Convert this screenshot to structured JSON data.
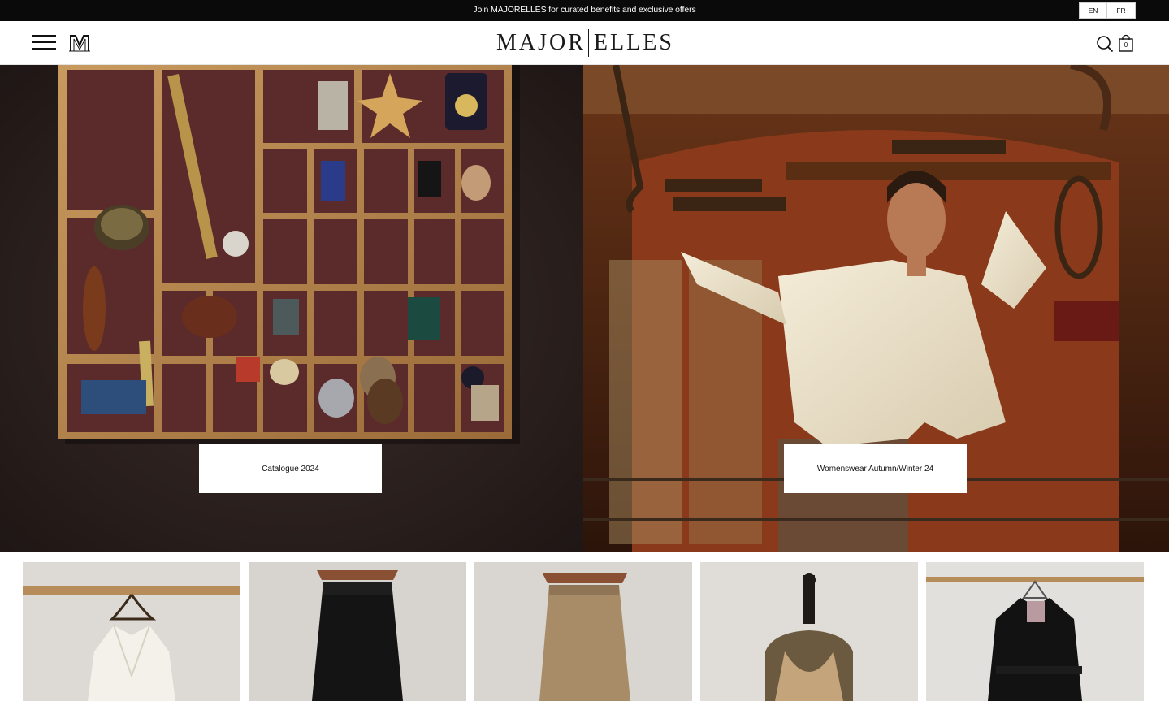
{
  "announcement": {
    "text": "Join MAJORELLES for curated benefits and exclusive offers",
    "languages": [
      "EN",
      "FR"
    ]
  },
  "header": {
    "menu_icon": "hamburger-menu-icon",
    "monogram": "M",
    "brand_left": "MAJOR",
    "brand_right": "ELLES",
    "search_icon": "search-icon",
    "bag_icon": "shopping-bag-icon",
    "bag_count": "0"
  },
  "hero": {
    "left": {
      "cta_label": "Catalogue 2024"
    },
    "right": {
      "cta_label": "Womenswear Autumn/Winter 24"
    }
  },
  "products": [
    {
      "name": "white-jacket"
    },
    {
      "name": "black-trousers"
    },
    {
      "name": "suede-trousers"
    },
    {
      "name": "camel-halter-top"
    },
    {
      "name": "black-coat"
    }
  ],
  "colors": {
    "announcement_bg": "#0a0a0a",
    "text": "#111111",
    "background": "#ffffff"
  }
}
